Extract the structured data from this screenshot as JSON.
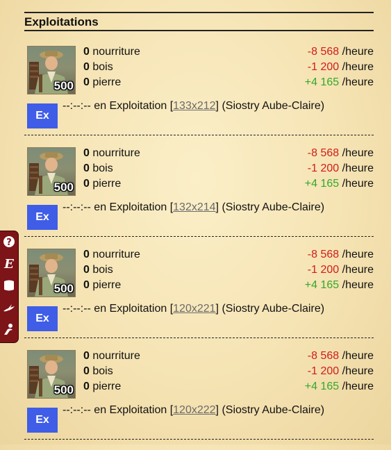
{
  "section": {
    "title": "Exploitations"
  },
  "entries": [
    {
      "level": "500",
      "resources": [
        {
          "qty": "0",
          "name": "nourriture",
          "rate": "-8 568",
          "unit": "/heure"
        },
        {
          "qty": "0",
          "name": "bois",
          "rate": "-1 200",
          "unit": "/heure"
        },
        {
          "qty": "0",
          "name": "pierre",
          "rate": "+4 165",
          "unit": "/heure"
        }
      ],
      "button_label": "Ex",
      "status_prefix": "--:--:-- en Exploitation [",
      "coords": "133x212",
      "status_suffix": "] (Siostry Aube-Claire)"
    },
    {
      "level": "500",
      "resources": [
        {
          "qty": "0",
          "name": "nourriture",
          "rate": "-8 568",
          "unit": "/heure"
        },
        {
          "qty": "0",
          "name": "bois",
          "rate": "-1 200",
          "unit": "/heure"
        },
        {
          "qty": "0",
          "name": "pierre",
          "rate": "+4 165",
          "unit": "/heure"
        }
      ],
      "button_label": "Ex",
      "status_prefix": "--:--:-- en Exploitation [",
      "coords": "132x214",
      "status_suffix": "] (Siostry Aube-Claire)"
    },
    {
      "level": "500",
      "resources": [
        {
          "qty": "0",
          "name": "nourriture",
          "rate": "-8 568",
          "unit": "/heure"
        },
        {
          "qty": "0",
          "name": "bois",
          "rate": "-1 200",
          "unit": "/heure"
        },
        {
          "qty": "0",
          "name": "pierre",
          "rate": "+4 165",
          "unit": "/heure"
        }
      ],
      "button_label": "Ex",
      "status_prefix": "--:--:-- en Exploitation [",
      "coords": "120x221",
      "status_suffix": "] (Siostry Aube-Claire)"
    },
    {
      "level": "500",
      "resources": [
        {
          "qty": "0",
          "name": "nourriture",
          "rate": "-8 568",
          "unit": "/heure"
        },
        {
          "qty": "0",
          "name": "bois",
          "rate": "-1 200",
          "unit": "/heure"
        },
        {
          "qty": "0",
          "name": "pierre",
          "rate": "+4 165",
          "unit": "/heure"
        }
      ],
      "button_label": "Ex",
      "status_prefix": "--:--:-- en Exploitation [",
      "coords": "120x222",
      "status_suffix": "] (Siostry Aube-Claire)"
    }
  ],
  "colors": {
    "negative": "#d21b1b",
    "positive": "#33a82a",
    "button": "#3f5de6",
    "toolbar": "#7d1417"
  },
  "toolbar": {
    "icons": [
      "help-icon",
      "chronicle-icon",
      "scroll-icon",
      "bird-icon",
      "character-icon"
    ]
  }
}
